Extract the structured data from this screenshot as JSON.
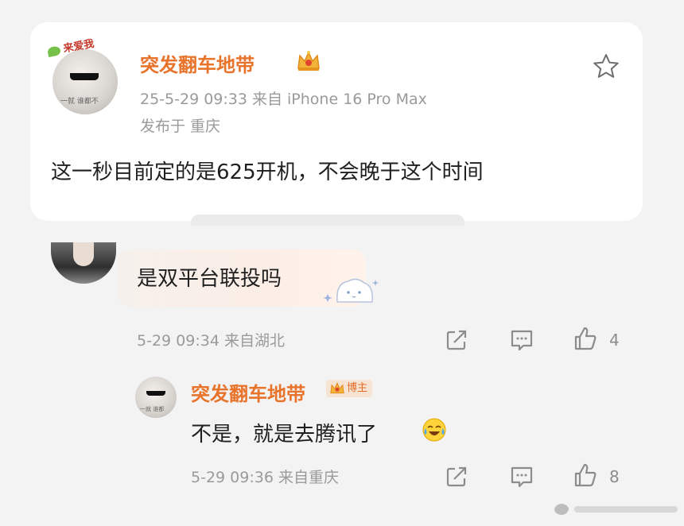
{
  "post": {
    "avatar_badge": "来爱我",
    "avatar_caption": "一就 谁都不",
    "username": "突发翻车地带",
    "meta": "25-5-29 09:33   来自 iPhone 16 Pro Max",
    "location": "发布于 重庆",
    "text": "这一秒目前定的是625开机，不会晚于这个时间"
  },
  "comment": {
    "text": "是双平台联投吗",
    "meta": "5-29 09:34   来自湖北",
    "likes": "4"
  },
  "reply": {
    "username": "突发翻车地带",
    "badge": "博主",
    "avatar_caption": "一就 谁都",
    "text": "不是，就是去腾讯了",
    "meta": "5-29 09:36   来自重庆",
    "likes": "8"
  },
  "colors": {
    "username": "#e8742c",
    "meta": "#9a9a9a",
    "icons": "#8c8c8c",
    "page_background": "#f3f3f3"
  },
  "icons": [
    "star-icon",
    "crown-icon",
    "share-icon",
    "comment-icon",
    "like-icon",
    "laugh-cry-emoji-icon"
  ]
}
